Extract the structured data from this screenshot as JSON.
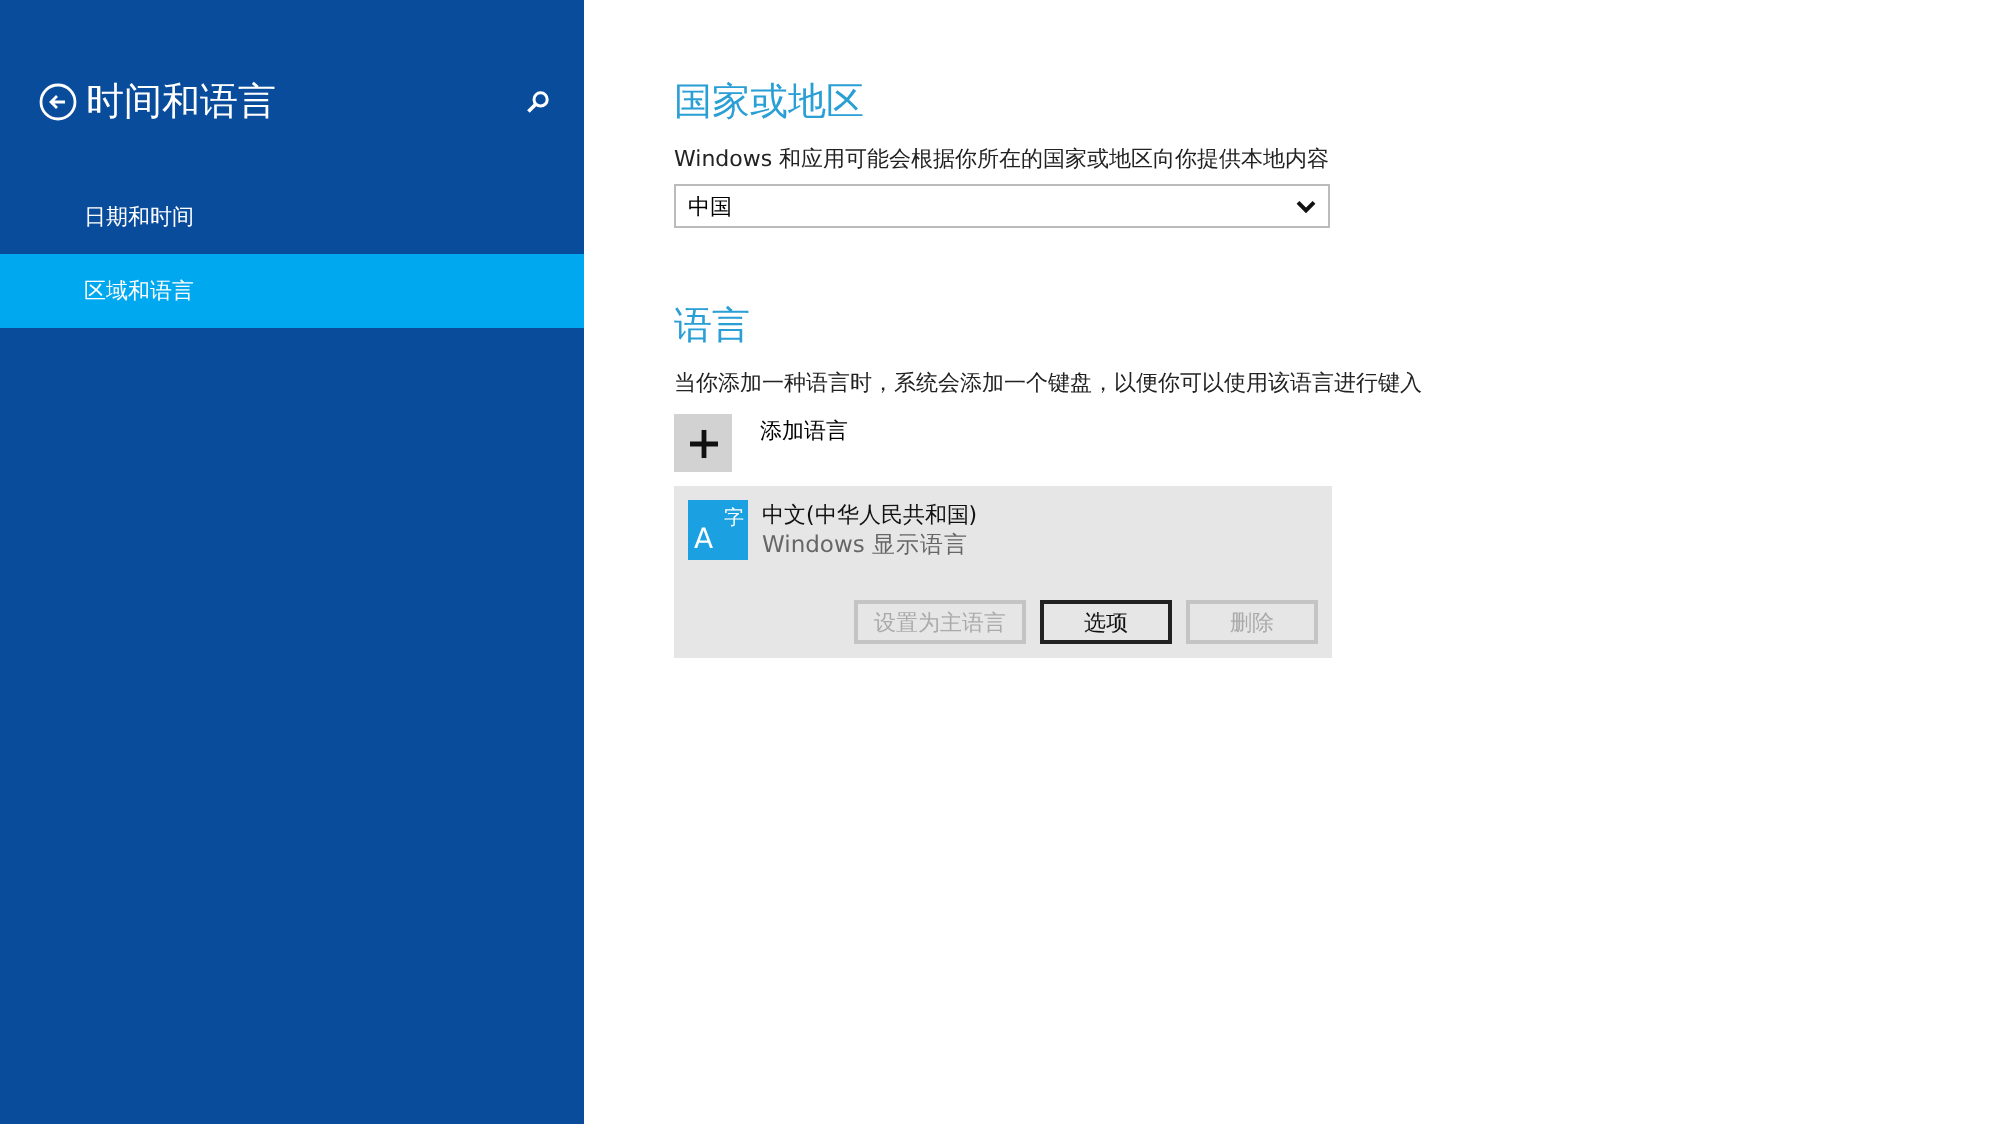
{
  "sidebar": {
    "title": "时间和语言",
    "items": [
      {
        "label": "日期和时间",
        "selected": false
      },
      {
        "label": "区域和语言",
        "selected": true
      }
    ]
  },
  "region": {
    "heading": "国家或地区",
    "description": "Windows 和应用可能会根据你所在的国家或地区向你提供本地内容",
    "dropdown": {
      "value": "中国"
    }
  },
  "language": {
    "heading": "语言",
    "description": "当你添加一种语言时，系统会添加一个键盘，以便你可以使用该语言进行键入",
    "add_label": "添加语言",
    "items": [
      {
        "icon_letter": "A",
        "icon_char": "字",
        "name": "中文(中华人民共和国)",
        "subtitle": "Windows 显示语言",
        "buttons": [
          {
            "label": "设置为主语言",
            "disabled": true
          },
          {
            "label": "选项",
            "disabled": false
          },
          {
            "label": "删除",
            "disabled": true
          }
        ]
      }
    ]
  }
}
